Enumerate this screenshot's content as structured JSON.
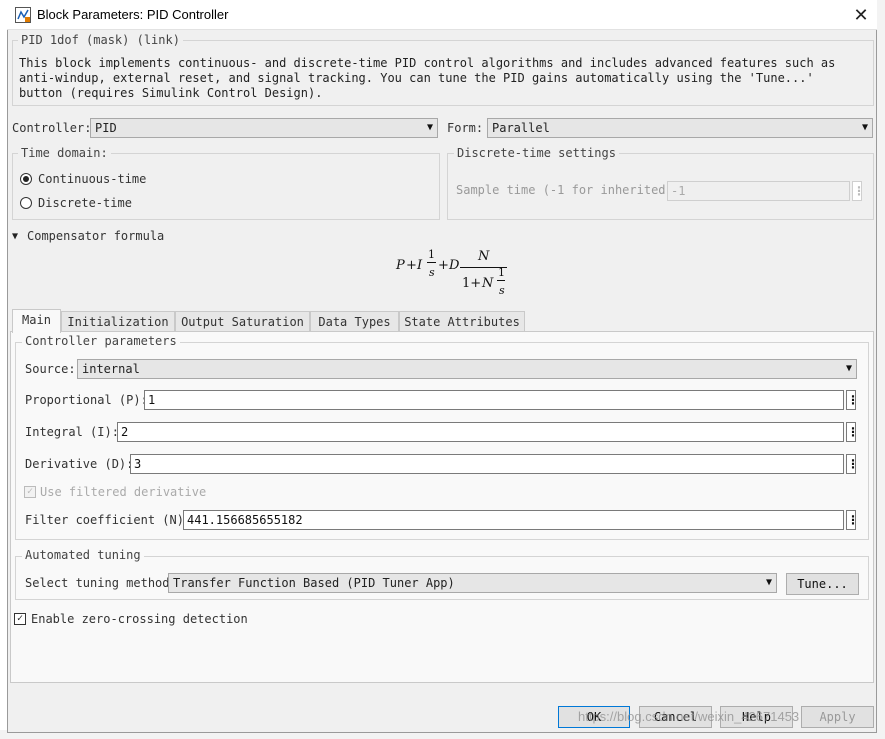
{
  "window": {
    "title": "Block Parameters: PID Controller",
    "close_glyph": "✕"
  },
  "description": {
    "title": "PID 1dof (mask) (link)",
    "text": "This block implements continuous- and discrete-time PID control algorithms and includes advanced features such as anti-windup, external reset, and signal tracking. You can tune the PID gains automatically using the 'Tune...' button (requires Simulink Control Design)."
  },
  "controller": {
    "label": "Controller:",
    "value": "PID"
  },
  "form": {
    "label": "Form:",
    "value": "Parallel"
  },
  "time_domain": {
    "title": "Time domain:",
    "options": [
      "Continuous-time",
      "Discrete-time"
    ],
    "selected": "Continuous-time"
  },
  "discrete_settings": {
    "title": "Discrete-time settings",
    "sample_time_label": "Sample time (-1 for inherited):",
    "sample_time_value": "-1"
  },
  "compensator": {
    "label": "Compensator formula",
    "formula": {
      "p": "P",
      "plus": "+",
      "i": "I",
      "one": "1",
      "s": "s",
      "d": "D",
      "n": "N",
      "denom_one_plus": "1+",
      "denom_n": "N"
    }
  },
  "tabs": [
    "Main",
    "Initialization",
    "Output Saturation",
    "Data Types",
    "State Attributes"
  ],
  "active_tab": "Main",
  "controller_parameters": {
    "title": "Controller parameters",
    "source_label": "Source:",
    "source_value": "internal",
    "p_label": "Proportional (P):",
    "p_value": "1",
    "i_label": "Integral (I):",
    "i_value": "2",
    "d_label": "Derivative (D):",
    "d_value": "3",
    "filtered_label": "Use filtered derivative",
    "filtered_checked": true,
    "n_label": "Filter coefficient (N):",
    "n_value": "441.156685655182"
  },
  "automated_tuning": {
    "title": "Automated tuning",
    "method_label": "Select tuning method:",
    "method_value": "Transfer Function Based (PID Tuner App)",
    "tune_button": "Tune..."
  },
  "zero_crossing": {
    "label": "Enable zero-crossing detection",
    "checked": true
  },
  "buttons": {
    "ok": "OK",
    "cancel": "Cancel",
    "help": "Help",
    "apply": "Apply"
  },
  "watermark": "https://blog.csdn.net/weixin_42671453",
  "icons": {
    "checkmark": "✓",
    "kebab": "⋮",
    "dropdown": "▼",
    "triangle": "▼"
  },
  "colors": {
    "dialog_bg": "#f0f0f0",
    "panel_bg": "#f9f9f9",
    "accent_border": "#0078d7"
  }
}
